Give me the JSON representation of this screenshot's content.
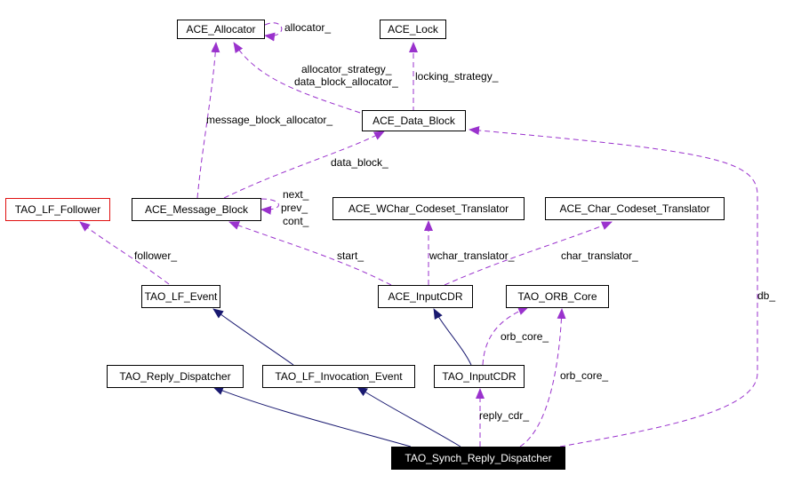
{
  "colors": {
    "usage_edge": "#9a32cd",
    "inheritance_edge": "#191970",
    "node_border": "#000000",
    "undocumented_border": "#e01010",
    "focus_fill": "#000000",
    "focus_text": "#ffffff"
  },
  "nodes": {
    "ace_allocator": "ACE_Allocator",
    "ace_lock": "ACE_Lock",
    "ace_data_block": "ACE_Data_Block",
    "tao_lf_follower": "TAO_LF_Follower",
    "ace_message_block": "ACE_Message_Block",
    "ace_wchar_codeset_translator": "ACE_WChar_Codeset_Translator",
    "ace_char_codeset_translator": "ACE_Char_Codeset_Translator",
    "tao_lf_event": "TAO_LF_Event",
    "ace_inputcdr": "ACE_InputCDR",
    "tao_orb_core": "TAO_ORB_Core",
    "tao_reply_dispatcher": "TAO_Reply_Dispatcher",
    "tao_lf_invocation_event": "TAO_LF_Invocation_Event",
    "tao_inputcdr": "TAO_InputCDR",
    "tao_synch_reply_dispatcher": "TAO_Synch_Reply_Dispatcher"
  },
  "edge_labels": {
    "allocator": "allocator_",
    "allocator_strategy": "allocator_strategy_",
    "data_block_allocator": "data_block_allocator_",
    "locking_strategy": "locking_strategy_",
    "message_block_allocator": "message_block_allocator_",
    "data_block": "data_block_",
    "next": "next_",
    "prev": "prev_",
    "cont": "cont_",
    "follower": "follower_",
    "start": "start_",
    "wchar_translator": "wchar_translator_",
    "char_translator": "char_translator_",
    "db": "db_",
    "orb_core_1": "orb_core_",
    "orb_core_2": "orb_core_",
    "reply_cdr": "reply_cdr_"
  },
  "edges": [
    {
      "from": "ace_allocator",
      "to": "ace_allocator",
      "kind": "usage",
      "label": "allocator"
    },
    {
      "from": "ace_data_block",
      "to": "ace_allocator",
      "kind": "usage",
      "label": "allocator_strategy"
    },
    {
      "from": "ace_data_block",
      "to": "ace_lock",
      "kind": "usage",
      "label": "locking_strategy"
    },
    {
      "from": "ace_message_block",
      "to": "ace_allocator",
      "kind": "usage",
      "label": "message_block_allocator"
    },
    {
      "from": "ace_message_block",
      "to": "ace_data_block",
      "kind": "usage",
      "label": "data_block"
    },
    {
      "from": "ace_message_block",
      "to": "ace_message_block",
      "kind": "usage",
      "label": "next"
    },
    {
      "from": "tao_lf_event",
      "to": "tao_lf_follower",
      "kind": "usage",
      "label": "follower"
    },
    {
      "from": "ace_inputcdr",
      "to": "ace_message_block",
      "kind": "usage",
      "label": "start"
    },
    {
      "from": "ace_inputcdr",
      "to": "ace_wchar_codeset_translator",
      "kind": "usage",
      "label": "wchar_translator"
    },
    {
      "from": "ace_inputcdr",
      "to": "ace_char_codeset_translator",
      "kind": "usage",
      "label": "char_translator"
    },
    {
      "from": "tao_inputcdr",
      "to": "ace_inputcdr",
      "kind": "inheritance"
    },
    {
      "from": "tao_inputcdr",
      "to": "tao_orb_core",
      "kind": "usage",
      "label": "orb_core_1"
    },
    {
      "from": "tao_lf_invocation_event",
      "to": "tao_lf_event",
      "kind": "inheritance"
    },
    {
      "from": "tao_synch_reply_dispatcher",
      "to": "tao_reply_dispatcher",
      "kind": "inheritance"
    },
    {
      "from": "tao_synch_reply_dispatcher",
      "to": "tao_lf_invocation_event",
      "kind": "inheritance"
    },
    {
      "from": "tao_synch_reply_dispatcher",
      "to": "tao_inputcdr",
      "kind": "usage",
      "label": "reply_cdr"
    },
    {
      "from": "tao_synch_reply_dispatcher",
      "to": "tao_orb_core",
      "kind": "usage",
      "label": "orb_core_2"
    },
    {
      "from": "tao_synch_reply_dispatcher",
      "to": "ace_data_block",
      "kind": "usage",
      "label": "db"
    }
  ]
}
